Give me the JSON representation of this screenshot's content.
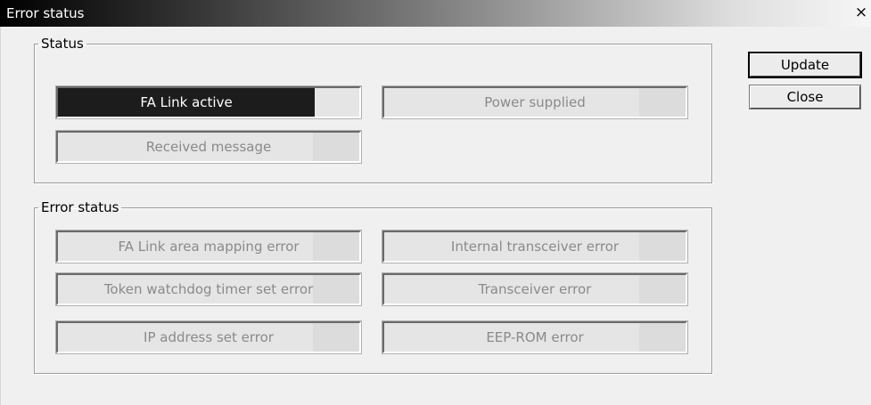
{
  "window": {
    "title": "Error status",
    "close_glyph": "×"
  },
  "status_group": {
    "label": "Status",
    "indicators": [
      {
        "label": "FA Link active",
        "state": "on"
      },
      {
        "label": "Power supplied",
        "state": "off"
      },
      {
        "label": "Received message",
        "state": "off"
      }
    ]
  },
  "error_group": {
    "label": "Error status",
    "indicators": [
      {
        "label": "FA Link area mapping error",
        "state": "off"
      },
      {
        "label": "Internal transceiver error",
        "state": "off"
      },
      {
        "label": "Token watchdog timer set error",
        "state": "off"
      },
      {
        "label": "Transceiver error",
        "state": "off"
      },
      {
        "label": "IP address set error",
        "state": "off"
      },
      {
        "label": "EEP-ROM error",
        "state": "off"
      }
    ]
  },
  "buttons": {
    "update": "Update",
    "close": "Close"
  },
  "colors": {
    "indicator_on": "#1c1c1c",
    "indicator_off": "#e5e5e5",
    "title_gradient_start": "#000000",
    "title_gradient_end": "#f6f6f6"
  }
}
